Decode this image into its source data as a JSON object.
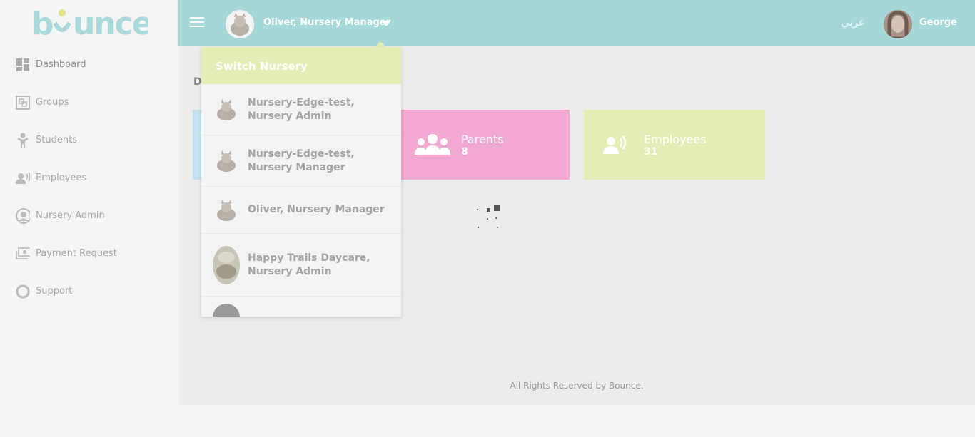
{
  "brand": {
    "logo_text": "bounce",
    "color": "#a9d9dc"
  },
  "sidebar": {
    "items": [
      {
        "label": "Dashboard",
        "icon": "dashboard-icon"
      },
      {
        "label": "Groups",
        "icon": "groups-icon"
      },
      {
        "label": "Students",
        "icon": "student-icon"
      },
      {
        "label": "Employees",
        "icon": "employee-icon"
      },
      {
        "label": "Nursery Admin",
        "icon": "user-circle-icon"
      },
      {
        "label": "Payment Request",
        "icon": "payment-icon"
      },
      {
        "label": "Support",
        "icon": "lifebuoy-icon"
      }
    ]
  },
  "topbar": {
    "current_nursery": "Oliver, Nursery Manager",
    "language": "عربي",
    "user_name": "George",
    "color": "#a6d8da"
  },
  "main": {
    "title_partial": "D",
    "cards": [
      {
        "label": "Parents",
        "count": "8",
        "color": "#f2a9d4"
      },
      {
        "label": "Employees",
        "count": "31",
        "color": "#e5ecb6"
      }
    ],
    "footer": "All Rights Reserved by Bounce."
  },
  "dropdown": {
    "header": "Switch Nursery",
    "items": [
      {
        "line1": "Nursery-Edge-test,",
        "line2": "Nursery Admin"
      },
      {
        "line1": "Nursery-Edge-test,",
        "line2": "Nursery Manager"
      },
      {
        "line1": "Oliver, Nursery Manager",
        "line2": ""
      },
      {
        "line1": "Happy Trails Daycare,",
        "line2": "Nursery Admin"
      }
    ]
  }
}
